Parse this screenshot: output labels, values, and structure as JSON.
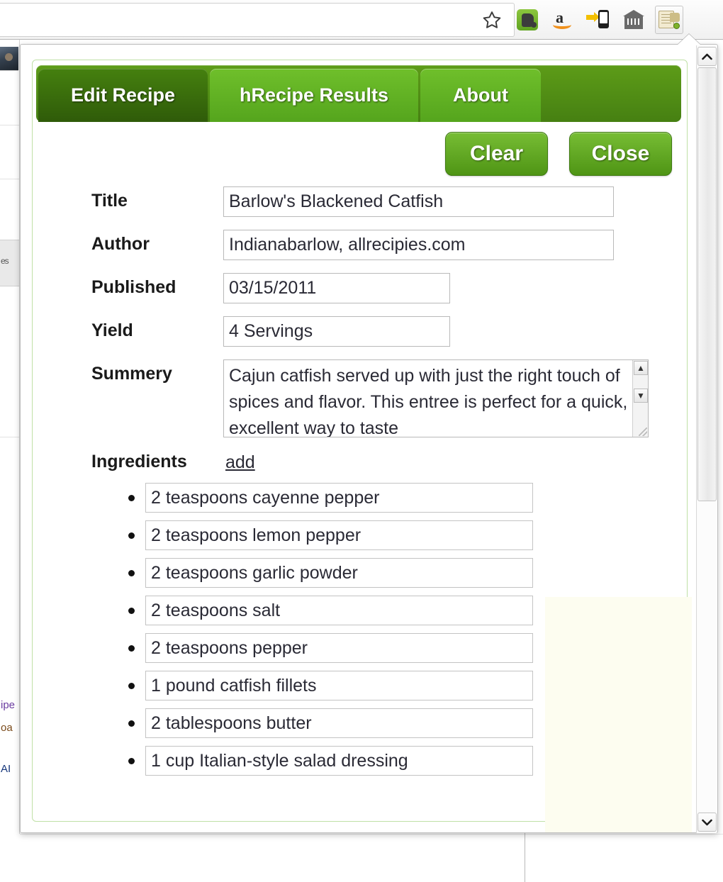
{
  "browser_toolbar": {
    "icons": [
      {
        "name": "bookmark-star-icon",
        "label": "Bookmark this page"
      },
      {
        "name": "evernote-clipper-icon",
        "label": "Evernote Web Clipper"
      },
      {
        "name": "amazon-icon",
        "label": "Amazon"
      },
      {
        "name": "send-to-device-icon",
        "label": "Send to device"
      },
      {
        "name": "building-icon",
        "label": "Archive"
      },
      {
        "name": "hrecipe-extension-icon",
        "label": "hRecipe Editor"
      }
    ]
  },
  "popup": {
    "tabs": [
      {
        "label": "Edit Recipe",
        "active": true
      },
      {
        "label": "hRecipe Results",
        "active": false
      },
      {
        "label": "About",
        "active": false
      }
    ],
    "actions": {
      "clear_label": "Clear",
      "close_label": "Close"
    },
    "form": {
      "fields": [
        {
          "label": "Title",
          "value": "Barlow's Blackened Catfish",
          "name": "title"
        },
        {
          "label": "Author",
          "value": "Indianabarlow, allrecipies.com",
          "name": "author"
        },
        {
          "label": "Published",
          "value": "03/15/2011",
          "name": "published"
        },
        {
          "label": "Yield",
          "value": "4 Servings",
          "name": "yield"
        }
      ],
      "summary": {
        "label": "Summery",
        "value": "Cajun catfish served up with just the right touch of spices and flavor. This entree is perfect for a quick, excellent way to taste"
      }
    },
    "ingredients": {
      "label": "Ingredients",
      "add_label": "add",
      "items": [
        "2 teaspoons cayenne pepper",
        "2 teaspoons lemon pepper",
        "2 teaspoons garlic powder",
        "2 teaspoons salt",
        "2 teaspoons pepper",
        "1 pound catfish fillets",
        "2 tablespoons butter",
        "1 cup Italian-style salad dressing"
      ]
    },
    "scrollbar": {
      "up_glyph": "▲",
      "down_glyph": "▼"
    }
  },
  "background_page": {
    "text_fragments": [
      "ipe",
      "oa",
      "AI"
    ],
    "gray_block_text": "es"
  },
  "colors": {
    "tabbar_green": "#4E8C15",
    "tab_active_green": "#3A6F0C",
    "tab_inactive_green": "#63B526",
    "button_green": "#5FA71C",
    "panel_border": "#BFE0A6",
    "ivory_panel": "#FDFDF0"
  }
}
